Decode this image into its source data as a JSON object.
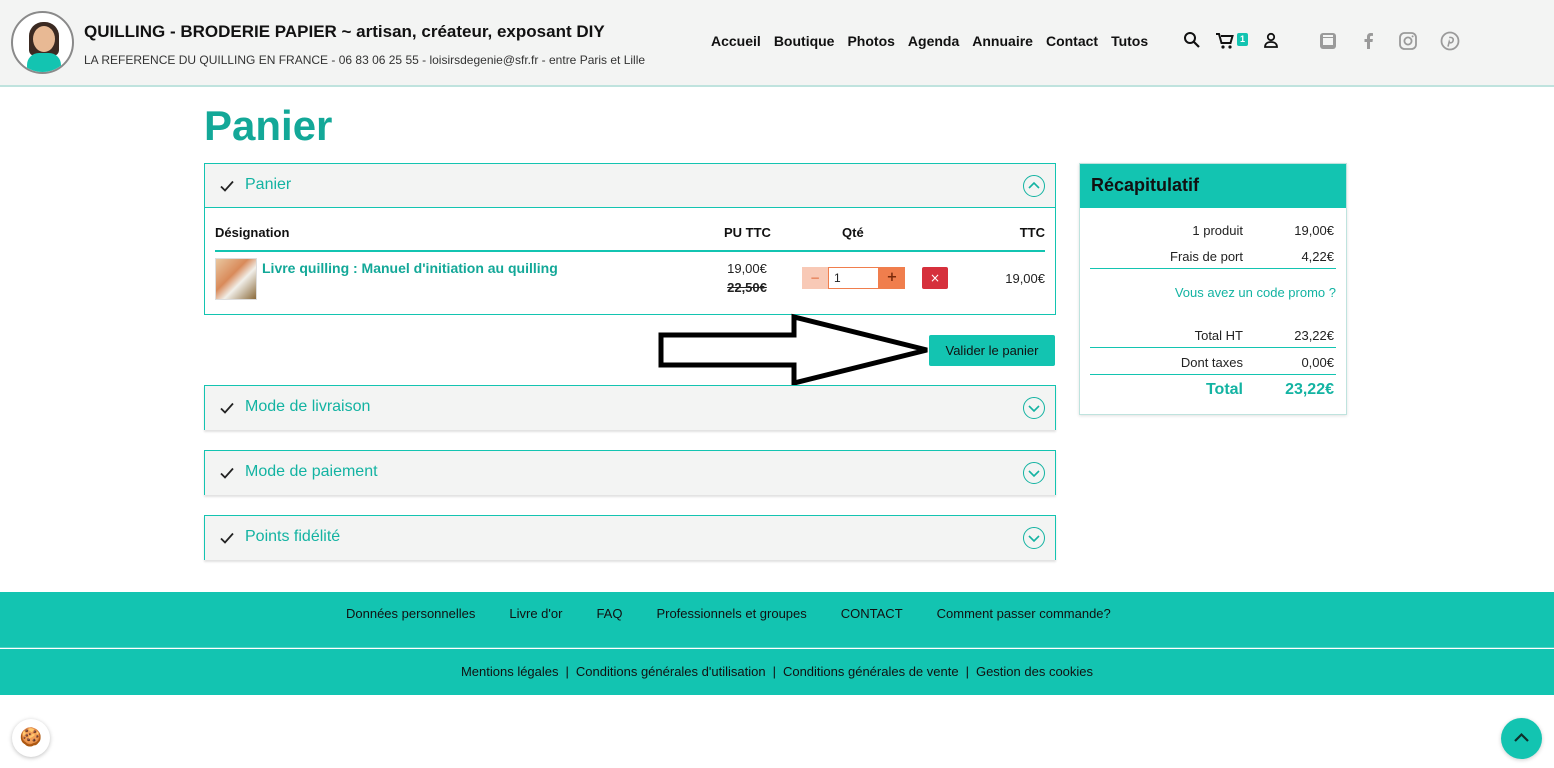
{
  "header": {
    "site_title": "QUILLING - BRODERIE PAPIER ~ artisan, créateur, exposant DIY",
    "subtitle": "LA REFERENCE DU QUILLING EN FRANCE - 06 83 06 25 55 - loisirsdegenie@sfr.fr - entre Paris et Lille",
    "nav": [
      "Accueil",
      "Boutique",
      "Photos",
      "Agenda",
      "Annuaire",
      "Contact",
      "Tutos"
    ],
    "cart_count": "1",
    "icons": [
      "search-icon",
      "cart-icon",
      "user-icon",
      "youtube-icon",
      "facebook-icon",
      "instagram-icon",
      "pinterest-icon"
    ]
  },
  "page": {
    "title": "Panier"
  },
  "cart": {
    "panel_title": "Panier",
    "columns": {
      "designation": "Désignation",
      "unit_price": "PU TTC",
      "qty": "Qté",
      "total": "TTC"
    },
    "items": [
      {
        "name": "Livre quilling : Manuel d'initiation au quilling",
        "price": "19,00€",
        "old_price": "22,50€",
        "qty": "1",
        "minus": "−",
        "plus": "+",
        "remove": "×",
        "total": "19,00€"
      }
    ],
    "validate_label": "Valider le panier"
  },
  "sections": [
    {
      "title": "Mode de livraison"
    },
    {
      "title": "Mode de paiement"
    },
    {
      "title": "Points fidélité"
    }
  ],
  "summary": {
    "title": "Récapitulatif",
    "products_label": "1 produit",
    "products_value": "19,00€",
    "shipping_label": "Frais de port",
    "shipping_value": "4,22€",
    "promo_link": "Vous avez un code promo ?",
    "total_ht_label": "Total HT",
    "total_ht_value": "23,22€",
    "taxes_label": "Dont taxes",
    "taxes_value": "0,00€",
    "total_label": "Total",
    "total_value": "23,22€"
  },
  "footer": {
    "links_top": [
      "Données personnelles",
      "Livre d'or",
      "FAQ",
      "Professionnels et groupes",
      "CONTACT",
      "Comment passer commande?"
    ],
    "links_bottom": [
      "Mentions légales",
      "Conditions générales d'utilisation",
      "Conditions générales de vente",
      "Gestion des cookies"
    ],
    "separator": "|"
  },
  "colors": {
    "accent": "#13c4b1",
    "accent_text": "#13a898",
    "remove": "#d6303c",
    "qty": "#f07e4d"
  }
}
